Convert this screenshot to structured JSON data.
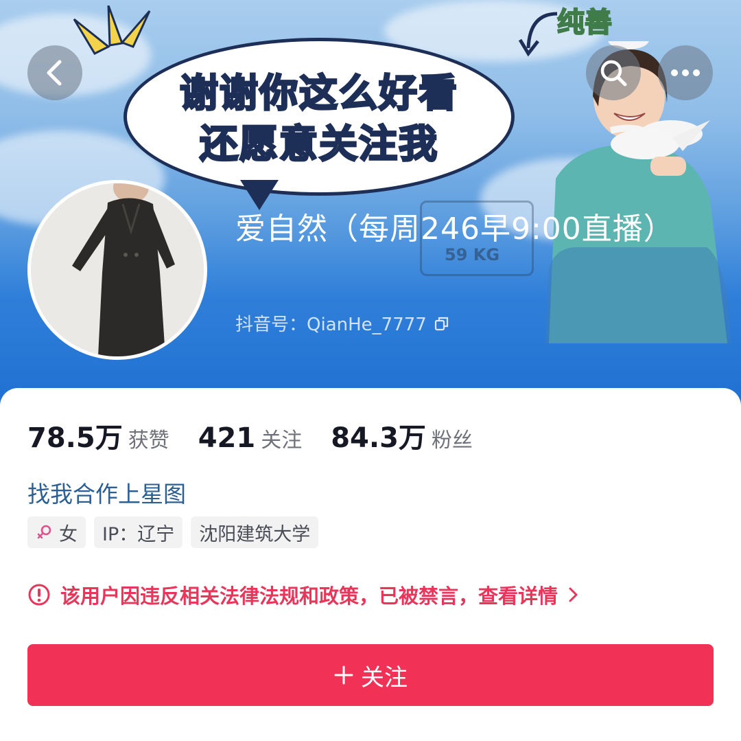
{
  "header": {
    "banner": {
      "bubble_line1": "谢谢你这么好看",
      "bubble_line2": "还愿意关注我",
      "corner_tag": "纯善",
      "scale_reading": "59 KG"
    },
    "back_icon": "chevron-left-icon",
    "search_icon": "search-icon",
    "more_icon": "more-dots-icon"
  },
  "profile": {
    "nickname": "爱自然（每周246早9:00直播）",
    "douyin_id": "抖音号：QianHe_7777",
    "copy_icon": "copy-icon"
  },
  "stats": [
    {
      "value": "78.5万",
      "label": "获赞"
    },
    {
      "value": "421",
      "label": "关注"
    },
    {
      "value": "84.3万",
      "label": "粉丝"
    }
  ],
  "collab_link": "找我合作上星图",
  "tags": [
    {
      "icon": "female-icon",
      "label": "女"
    },
    {
      "label": "IP：辽宁"
    },
    {
      "label": "沈阳建筑大学"
    }
  ],
  "warning": {
    "text": "该用户因违反相关法律法规和政策，已被禁言，查看详情",
    "icon": "exclamation-circle-icon"
  },
  "follow_button": {
    "label": "关注",
    "icon": "plus-icon"
  },
  "colors": {
    "accent": "#f23156",
    "warning": "#e8365a",
    "link": "#2b5f93"
  }
}
